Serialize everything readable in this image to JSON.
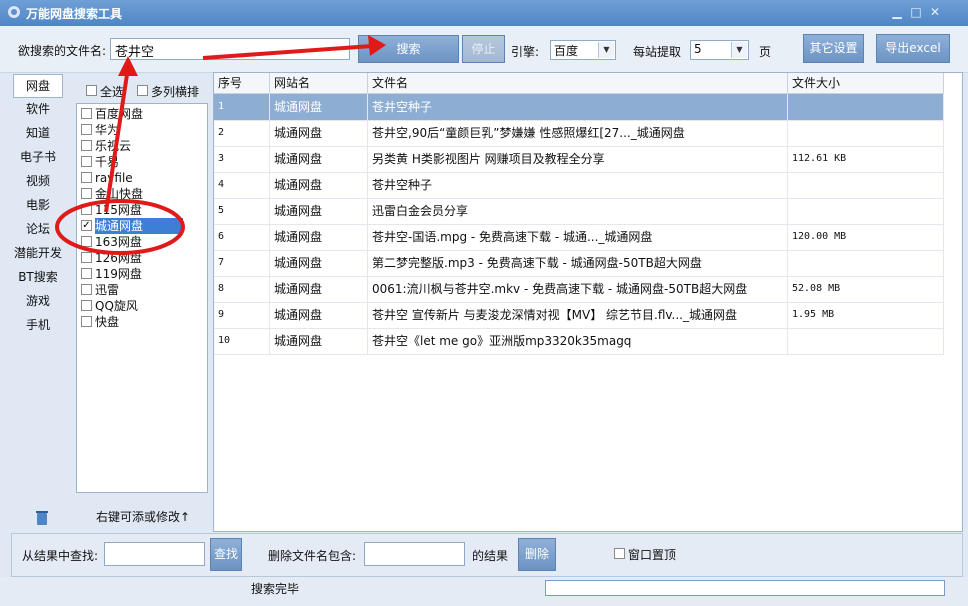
{
  "window": {
    "title": "万能网盘搜索工具"
  },
  "toolbar": {
    "filename_label": "欲搜索的文件名:",
    "filename_value": "苍井空",
    "search_btn": "搜索",
    "stop_btn": "停止",
    "engine_label": "引擎:",
    "engine_value": "百度",
    "per_site_label": "每站提取",
    "per_site_value": "5",
    "page_unit": "页",
    "other_settings_btn": "其它设置",
    "export_btn": "导出excel"
  },
  "categories": [
    "网盘",
    "软件",
    "知道",
    "电子书",
    "视频",
    "电影",
    "论坛",
    "潜能开发",
    "BT搜索",
    "游戏",
    "手机"
  ],
  "site_panel": {
    "select_all": "全选",
    "multi_col": "多列横排",
    "sites": [
      "百度网盘",
      "华为",
      "乐视云",
      "千易",
      "rayfile",
      "金山快盘",
      "115网盘",
      "城通网盘",
      "163网盘",
      "126网盘",
      "119网盘",
      "迅雷",
      "QQ旋风",
      "快盘"
    ],
    "checked": [
      "城通网盘"
    ],
    "footer": "右键可添或修改↑"
  },
  "table": {
    "headers": [
      "序号",
      "网站名",
      "文件名",
      "文件大小"
    ],
    "rows": [
      {
        "no": "1",
        "site": "城通网盘",
        "name": "苍井空种子",
        "size": ""
      },
      {
        "no": "2",
        "site": "城通网盘",
        "name": "苍井空,90后“童颜巨乳”梦嫌嫌 性感照爆红[27..._城通网盘",
        "size": ""
      },
      {
        "no": "3",
        "site": "城通网盘",
        "name": "另类黄 H类影视图片 网赚项目及教程全分享",
        "size": "112.61 KB"
      },
      {
        "no": "4",
        "site": "城通网盘",
        "name": "苍井空种子",
        "size": ""
      },
      {
        "no": "5",
        "site": "城通网盘",
        "name": "迅雷白金会员分享",
        "size": ""
      },
      {
        "no": "6",
        "site": "城通网盘",
        "name": "苍井空-国语.mpg - 免费高速下载 - 城通..._城通网盘",
        "size": "120.00 MB"
      },
      {
        "no": "7",
        "site": "城通网盘",
        "name": "第二梦完整版.mp3 - 免费高速下载 - 城通网盘-50TB超大网盘",
        "size": ""
      },
      {
        "no": "8",
        "site": "城通网盘",
        "name": "0061:流川枫与苍井空.mkv - 免费高速下载 - 城通网盘-50TB超大网盘",
        "size": "52.08 MB"
      },
      {
        "no": "9",
        "site": "城通网盘",
        "name": "苍井空 宣传新片 与麦浚龙深情对视【MV】 综艺节目.flv..._城通网盘",
        "size": "1.95 MB"
      },
      {
        "no": "10",
        "site": "城通网盘",
        "name": "苍井空《let me go》亚洲版mp3320k35magq",
        "size": ""
      }
    ]
  },
  "bottom": {
    "find_label": "从结果中查找:",
    "find_btn": "查找",
    "delete_label": "删除文件名包含:",
    "result_label": "的结果",
    "delete_btn": "删除",
    "topmost_label": "窗口置顶"
  },
  "status": {
    "text": "搜索完毕"
  }
}
